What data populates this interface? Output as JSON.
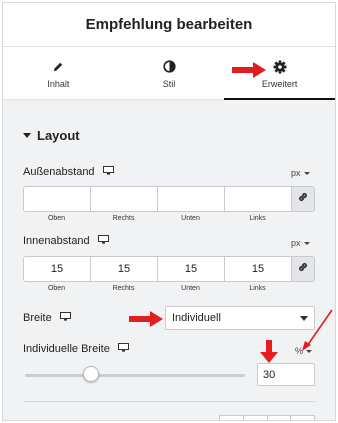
{
  "header": {
    "title": "Empfehlung bearbeiten"
  },
  "tabs": [
    {
      "label": "Inhalt",
      "icon": "pencil-icon",
      "active": false
    },
    {
      "label": "Stil",
      "icon": "contrast-icon",
      "active": false
    },
    {
      "label": "Erweitert",
      "icon": "gear-icon",
      "active": true
    }
  ],
  "section": {
    "title": "Layout"
  },
  "margin": {
    "label": "Außenabstand",
    "unit": "px",
    "values": [
      "",
      "",
      "",
      ""
    ],
    "sides": [
      "Oben",
      "Rechts",
      "Unten",
      "Links"
    ]
  },
  "padding": {
    "label": "Innenabstand",
    "unit": "px",
    "values": [
      "15",
      "15",
      "15",
      "15"
    ],
    "sides": [
      "Oben",
      "Rechts",
      "Unten",
      "Links"
    ]
  },
  "width": {
    "label": "Breite",
    "selected": "Individuell"
  },
  "custom_width": {
    "label": "Individuelle Breite",
    "unit": "%",
    "value": "30",
    "slider_fraction": 0.3
  },
  "colors": {
    "accent": "#111111",
    "annotation": "#e41e1e",
    "panel_bg": "#f1f2f4"
  }
}
